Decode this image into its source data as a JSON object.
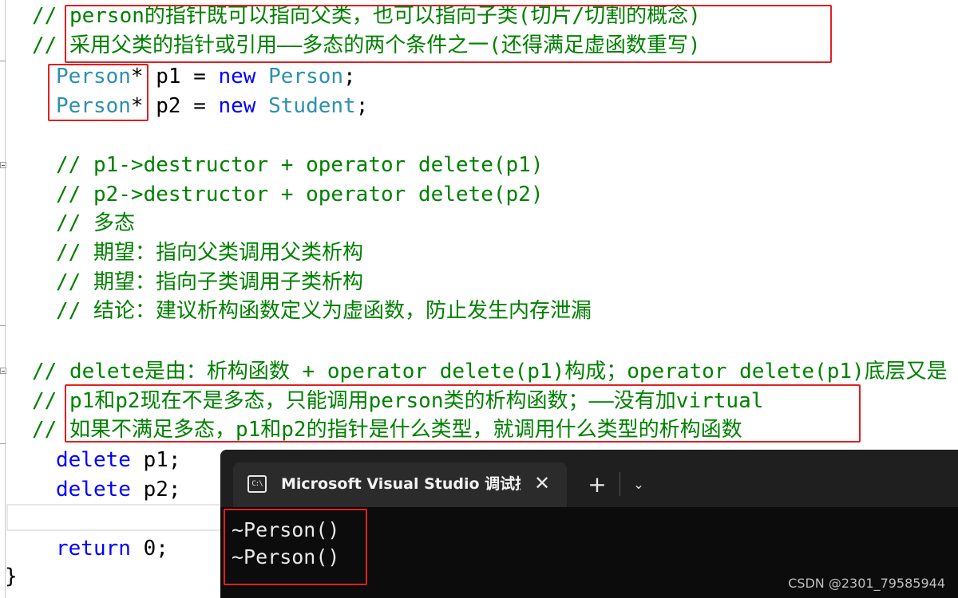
{
  "code": {
    "line1": "// person的指针既可以指向父类，也可以指向子类(切片/切割的概念)",
    "line2": "// 采用父类的指针或引用——多态的两个条件之一(还得满足虚函数重写)",
    "line3": {
      "type": "Person",
      "star": "*",
      "rest1": " p1 = ",
      "kw": "new",
      "sp": " ",
      "ctor": "Person",
      "end": ";"
    },
    "line4": {
      "type": "Person",
      "star": "*",
      "rest1": " p2 = ",
      "kw": "new",
      "sp": " ",
      "ctor": "Student",
      "end": ";"
    },
    "line5": "// p1->destructor + operator delete(p1)",
    "line6": "// p2->destructor + operator delete(p2)",
    "line7": "// 多态",
    "line8": "// 期望：指向父类调用父类析构",
    "line9": "// 期望：指向子类调用子类析构",
    "line10": "// 结论：建议析构函数定义为虚函数，防止发生内存泄漏",
    "line11": "// delete是由：析构函数 + operator delete(p1)构成；operator delete(p1)底层又是",
    "line12": "// p1和p2现在不是多态，只能调用person类的析构函数；——没有加virtual",
    "line13": "// 如果不满足多态，p1和p2的指针是什么类型，就调用什么类型的析构函数",
    "line14": {
      "kw": "delete",
      "rest": " p1;"
    },
    "line15": {
      "kw": "delete",
      "rest": " p2;"
    },
    "line16": {
      "kw": "return",
      "rest": " 0;"
    },
    "line17": "}"
  },
  "terminal": {
    "tab_title": "Microsoft Visual Studio 调试控制台",
    "tab_icon": "C:\\",
    "close_icon": "✕",
    "new_tab_icon": "+",
    "dropdown_icon": "⌄",
    "output": [
      "~Person()",
      "~Person()"
    ]
  },
  "watermark": "CSDN @2301_79585944",
  "colors": {
    "comment": "#008000",
    "type": "#2b91af",
    "keyword": "#0000ff",
    "highlight_box": "#e02020",
    "terminal_bg": "#0c0c0c"
  }
}
